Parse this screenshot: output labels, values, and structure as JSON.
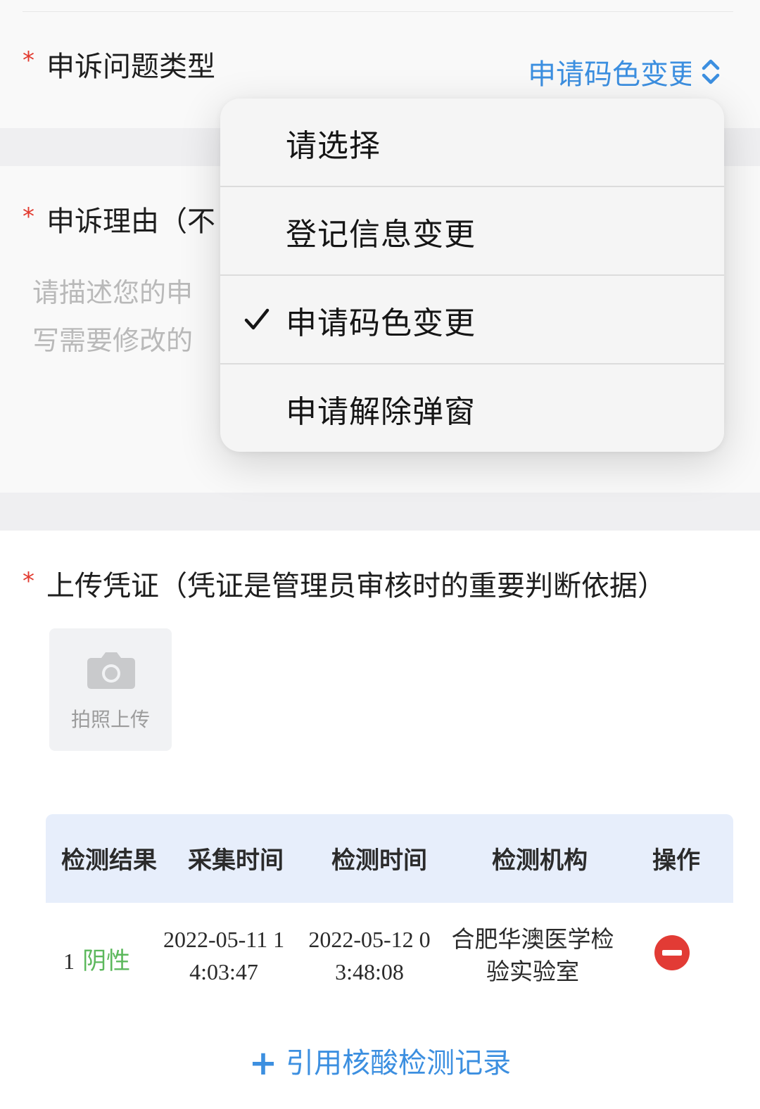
{
  "form": {
    "required_mark": "*",
    "issue_type": {
      "label": "申诉问题类型",
      "selected_display": "申请码色变更"
    },
    "reason": {
      "label_visible": "申诉理由（不",
      "placeholder_line1": "请描述您的申",
      "placeholder_line2": "写需要修改的"
    },
    "upload": {
      "label": "上传凭证（凭证是管理员审核时的重要判断依据）",
      "button_label": "拍照上传"
    }
  },
  "dropdown": {
    "options": [
      {
        "label": "请选择",
        "selected": false
      },
      {
        "label": "登记信息变更",
        "selected": false
      },
      {
        "label": "申请码色变更",
        "selected": true
      },
      {
        "label": "申请解除弹窗",
        "selected": false
      }
    ]
  },
  "records_table": {
    "headers": [
      "检测结果",
      "采集时间",
      "检测时间",
      "检测机构",
      "操作"
    ],
    "rows": [
      {
        "index": "1",
        "result": "阴性",
        "collect_time_line1": "2022-05-11 1",
        "collect_time_line2": "4:03:47",
        "test_time_line1": "2022-05-12 0",
        "test_time_line2": "3:48:08",
        "org_line1": "合肥华澳医学检",
        "org_line2": "验实验室"
      }
    ]
  },
  "add_record": {
    "icon": "plus-icon",
    "label": "引用核酸检测记录"
  },
  "colors": {
    "accent_blue": "#3c8fe0",
    "required_red": "#e23a2f",
    "negative_green": "#5cb85c",
    "remove_red": "#e23b35"
  }
}
